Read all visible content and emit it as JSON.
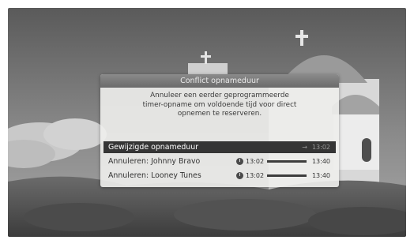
{
  "dialog": {
    "title": "Conflict opnameduur",
    "message_lines": [
      "Annuleer een eerder geprogrammeerde",
      "timer-opname om voldoende tijd voor direct",
      "opnemen te reserveren."
    ],
    "rows": [
      {
        "label": "Gewijzigde opnameduur",
        "arrow": "→",
        "end_time": "13:02",
        "selected": true
      },
      {
        "label": "Annuleren: Johnny Bravo",
        "icon": "clock-icon",
        "start_time": "13:02",
        "end_time": "13:40",
        "selected": false
      },
      {
        "label": "Annuleren: Looney Tunes",
        "icon": "clock-icon",
        "start_time": "13:02",
        "end_time": "13:40",
        "selected": false
      }
    ]
  },
  "colors": {
    "title_bar": "#7a7a7a",
    "panel": "#eeeeec",
    "selected_row": "#353535"
  }
}
